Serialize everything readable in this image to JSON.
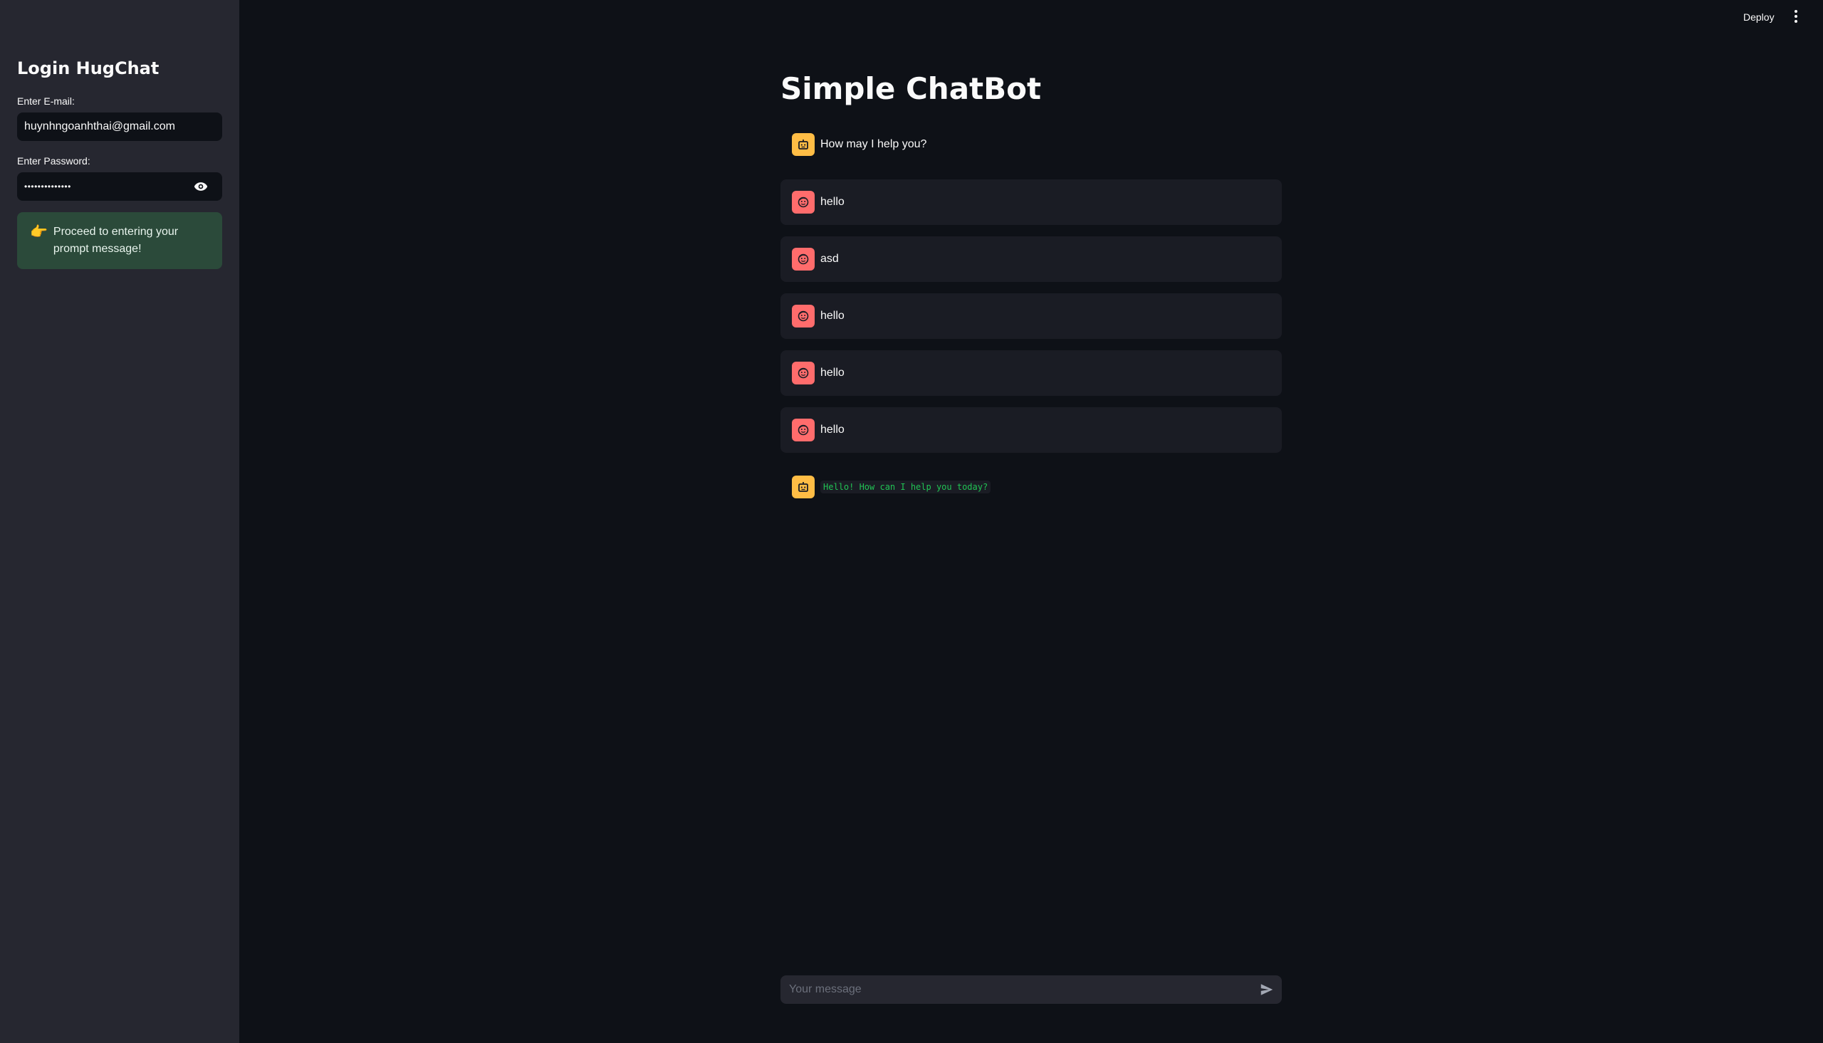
{
  "sidebar": {
    "title": "Login HugChat",
    "email_label": "Enter E-mail:",
    "email_value": "huynhngoanhthai@gmail.com",
    "password_label": "Enter Password:",
    "password_value": "••••••••••••••",
    "notice_emoji": "👉",
    "notice_text": "Proceed to entering your prompt message!"
  },
  "header": {
    "deploy_label": "Deploy"
  },
  "main": {
    "title": "Simple ChatBot",
    "messages": [
      {
        "role": "assistant",
        "text": "How may I help you?"
      },
      {
        "role": "user",
        "text": "hello"
      },
      {
        "role": "user",
        "text": "asd"
      },
      {
        "role": "user",
        "text": "hello"
      },
      {
        "role": "user",
        "text": "hello"
      },
      {
        "role": "user",
        "text": "hello"
      },
      {
        "role": "assistant",
        "text": "Hello! How can I help you today?"
      }
    ],
    "chat_placeholder": "Your message"
  },
  "colors": {
    "bot_avatar": "#ffbd45",
    "user_avatar": "#ff6c6c",
    "success_bg": "#2b4a3a",
    "code_text": "#21c354"
  }
}
